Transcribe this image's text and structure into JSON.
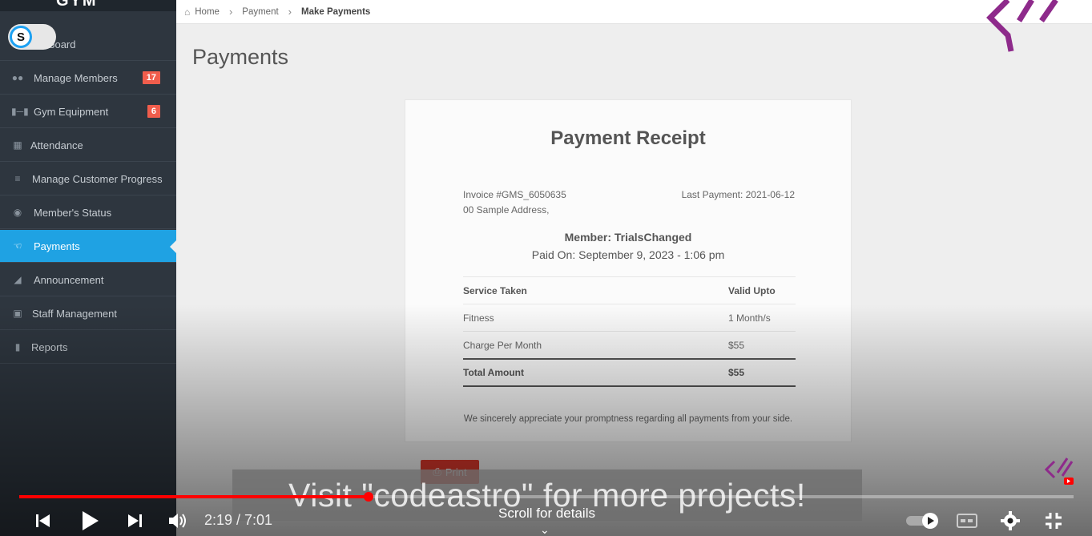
{
  "brand": {
    "name": "GYM SYSTEM"
  },
  "extension": {
    "letter": "S"
  },
  "sidebar": {
    "items": [
      {
        "label": "Dashboard",
        "icon": "dashboard-icon",
        "badge": ""
      },
      {
        "label": "Manage Members",
        "icon": "users-icon",
        "badge": "17"
      },
      {
        "label": "Gym Equipment",
        "icon": "dumbbell-icon",
        "badge": "6"
      },
      {
        "label": "Attendance",
        "icon": "calendar-icon",
        "badge": ""
      },
      {
        "label": "Manage Customer Progress",
        "icon": "list-icon",
        "badge": ""
      },
      {
        "label": "Member's Status",
        "icon": "eye-icon",
        "badge": ""
      },
      {
        "label": "Payments",
        "icon": "hand-money-icon",
        "badge": "",
        "active": true
      },
      {
        "label": "Announcement",
        "icon": "megaphone-icon",
        "badge": ""
      },
      {
        "label": "Staff Management",
        "icon": "briefcase-icon",
        "badge": ""
      },
      {
        "label": "Reports",
        "icon": "file-icon",
        "badge": ""
      }
    ],
    "first_item_visible": "hboard"
  },
  "breadcrumb": {
    "home": "Home",
    "payment": "Payment",
    "current": "Make Payments"
  },
  "page": {
    "title": "Payments"
  },
  "receipt": {
    "title": "Payment Receipt",
    "invoice": "Invoice #GMS_6050635",
    "address": "00 Sample Address,",
    "last_payment": "Last Payment: 2021-06-12",
    "member": "Member: TrialsChanged",
    "paid_on": "Paid On: September 9, 2023 - 1:06 pm",
    "headers": {
      "service": "Service Taken",
      "valid": "Valid Upto"
    },
    "rows": [
      {
        "c1": "Fitness",
        "c2": "1 Month/s"
      },
      {
        "c1": "Charge Per Month",
        "c2": "$55"
      }
    ],
    "total": {
      "c1": "Total Amount",
      "c2": "$55"
    },
    "thanks": "We sincerely appreciate your promptness regarding all payments from your side."
  },
  "print_button": {
    "label": "Print",
    "color": "#d9372b"
  },
  "video": {
    "banner": "Visit \"codeastro\" for more projects!",
    "time": "2:19 / 7:01",
    "progress": 0.331,
    "scroll_hint": "Scroll for details",
    "accent": "#ff0000"
  },
  "colors": {
    "sidebar": "#2e363f",
    "active": "#1fa2e3",
    "badge": "#f05d4c",
    "logo": "#8e2a8b"
  }
}
